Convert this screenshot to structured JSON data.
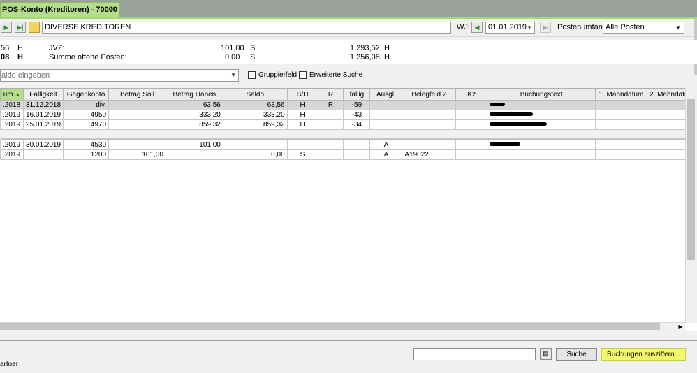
{
  "tab": {
    "title": "POS-Konto  (Kreditoren) - 70000",
    "close": "✕"
  },
  "toolbar": {
    "account_name": "DIVERSE KREDITOREN",
    "wj_label": "WJ:",
    "wj_date": "01.01.2019",
    "postenumfang_label": "Postenumfang:",
    "postenumfang_value": "Alle Posten"
  },
  "summary": {
    "row1": {
      "left_amount": "56",
      "left_sh": "H",
      "label": "JVZ:",
      "mid_amount": "101,00",
      "mid_sh": "S",
      "right_amount": "1.293,52",
      "right_sh": "H"
    },
    "row2": {
      "left_amount": "08",
      "left_sh": "H",
      "label": "Summe offene Posten:",
      "mid_amount": "0,00",
      "mid_sh": "S",
      "right_amount": "1.256,08",
      "right_sh": "H"
    }
  },
  "filter": {
    "placeholder": "aldo eingeben",
    "gruppierfeld": "Gruppierfeld",
    "erweiterte_suche": "Erweiterte Suche"
  },
  "grid": {
    "columns": [
      "um",
      "Fälligkeit",
      "Gegenkonto",
      "Betrag Soll",
      "Betrag Haben",
      "Saldo",
      "S/H",
      "R",
      "fällig",
      "Ausgl.",
      "Belegfeld 2",
      "Kz",
      "Buchungstext",
      "1. Mahndatum",
      "2. Mahndatum"
    ],
    "rows_open": [
      {
        "datum": ".2018",
        "faelligkeit": "31.12.2018",
        "gegenkonto": "div.",
        "soll": "",
        "haben": "63,56",
        "saldo": "63,56",
        "sh": "H",
        "r": "R",
        "faellig": "-59",
        "ausgl": "",
        "belegfeld2": "",
        "kz": ""
      },
      {
        "datum": ".2019",
        "faelligkeit": "16.01.2019",
        "gegenkonto": "4950",
        "soll": "",
        "haben": "333,20",
        "saldo": "333,20",
        "sh": "H",
        "r": "",
        "faellig": "-43",
        "ausgl": "",
        "belegfeld2": "",
        "kz": ""
      },
      {
        "datum": ".2019",
        "faelligkeit": "25.01.2019",
        "gegenkonto": "4970",
        "soll": "",
        "haben": "859,32",
        "saldo": "859,32",
        "sh": "H",
        "r": "",
        "faellig": "-34",
        "ausgl": "",
        "belegfeld2": "",
        "kz": ""
      }
    ],
    "rows_closed": [
      {
        "datum": ".2019",
        "faelligkeit": "30.01.2019",
        "gegenkonto": "4530",
        "soll": "",
        "haben": "101,00",
        "saldo": "",
        "sh": "",
        "r": "",
        "faellig": "",
        "ausgl": "A",
        "belegfeld2": "",
        "kz": ""
      },
      {
        "datum": ".2019",
        "faelligkeit": "",
        "gegenkonto": "1200",
        "soll": "101,00",
        "haben": "",
        "saldo": "0,00",
        "sh": "S",
        "r": "",
        "faellig": "",
        "ausgl": "A",
        "belegfeld2": "A19022",
        "kz": ""
      }
    ]
  },
  "bottom": {
    "search_button": "Suche",
    "ausziffern_button": "Buchungen ausziffern...",
    "partner_label": "artner"
  },
  "colors": {
    "tab_green": "#b5dd8c",
    "highlight_yellow": "#f2f86b",
    "selected_row": "#d7d7d7"
  }
}
